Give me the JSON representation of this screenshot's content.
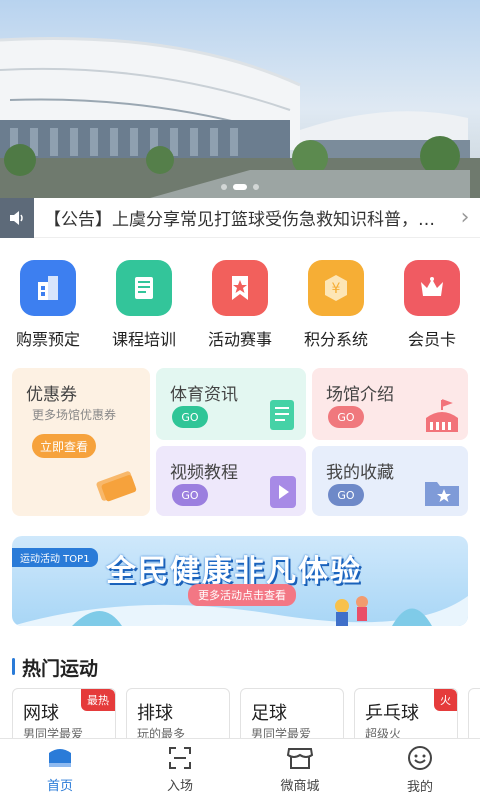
{
  "notice": {
    "text": "【公告】上虞分享常见打篮球受伤急救知识科普，你知道…",
    "speaker_icon": "speaker-icon",
    "chevron_icon": "chevron-right-icon"
  },
  "menu": [
    {
      "label": "购票预定",
      "icon": "building-icon",
      "color": "#3d7ff0"
    },
    {
      "label": "课程培训",
      "icon": "book-icon",
      "color": "#33c59a"
    },
    {
      "label": "活动赛事",
      "icon": "ribbon-star-icon",
      "color": "#f2605c"
    },
    {
      "label": "积分系统",
      "icon": "yen-coin-icon",
      "color": "#f6ae35"
    },
    {
      "label": "会员卡",
      "icon": "crown-icon",
      "color": "#f05b62"
    }
  ],
  "cards": {
    "coupon": {
      "title": "优惠券",
      "subtitle": "更多场馆优惠券",
      "cta": "立即查看"
    },
    "news": {
      "title": "体育资讯",
      "go": "GO"
    },
    "venue": {
      "title": "场馆介绍",
      "go": "GO"
    },
    "video": {
      "title": "视频教程",
      "go": "GO"
    },
    "favorites": {
      "title": "我的收藏",
      "go": "GO"
    }
  },
  "promo": {
    "tag": "运动活动 TOP1",
    "headline": "全民健康非凡体验",
    "pill": "更多活动点击查看"
  },
  "hot": {
    "title": "热门运动",
    "items": [
      {
        "name": "网球",
        "desc": "男同学最爱",
        "badge": "最热"
      },
      {
        "name": "排球",
        "desc": "玩的最多",
        "badge": ""
      },
      {
        "name": "足球",
        "desc": "男同学最爱",
        "badge": ""
      },
      {
        "name": "乒乓球",
        "desc": "超级火",
        "badge": "火"
      }
    ]
  },
  "tabs": [
    {
      "label": "首页",
      "icon": "home-icon",
      "active": true
    },
    {
      "label": "入场",
      "icon": "scan-icon",
      "active": false
    },
    {
      "label": "微商城",
      "icon": "store-icon",
      "active": false
    },
    {
      "label": "我的",
      "icon": "profile-icon",
      "active": false
    }
  ],
  "colors": {
    "accent": "#2a7bd8",
    "badge": "#e53b3b"
  }
}
